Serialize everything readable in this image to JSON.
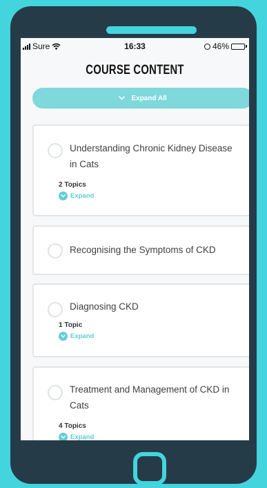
{
  "status_bar": {
    "carrier": "Sure",
    "time": "16:33",
    "battery_percent": "46%",
    "battery_level": 0.46,
    "icons": [
      "signal-icon",
      "wifi-icon",
      "orientation-lock-icon",
      "battery-icon"
    ]
  },
  "page": {
    "title": "COURSE CONTENT"
  },
  "expand_all": {
    "label": "Expand All",
    "icon": "chevron-down-icon"
  },
  "modules": [
    {
      "title": "Understanding Chronic Kidney Disease in Cats",
      "topics": "2 Topics",
      "expand_label": "Expand"
    },
    {
      "title": "Recognising the Symptoms of CKD"
    },
    {
      "title": "Diagnosing CKD",
      "topics": "1 Topic",
      "expand_label": "Expand"
    },
    {
      "title": "Treatment and Management of CKD in Cats",
      "topics": "4 Topics",
      "expand_label": "Expand"
    }
  ],
  "colors": {
    "background": "#44d4de",
    "phone_body": "#263b48",
    "accent": "#62ced5",
    "expand_all_button": "#7ed8dc",
    "screen": "#f7f8f9"
  }
}
